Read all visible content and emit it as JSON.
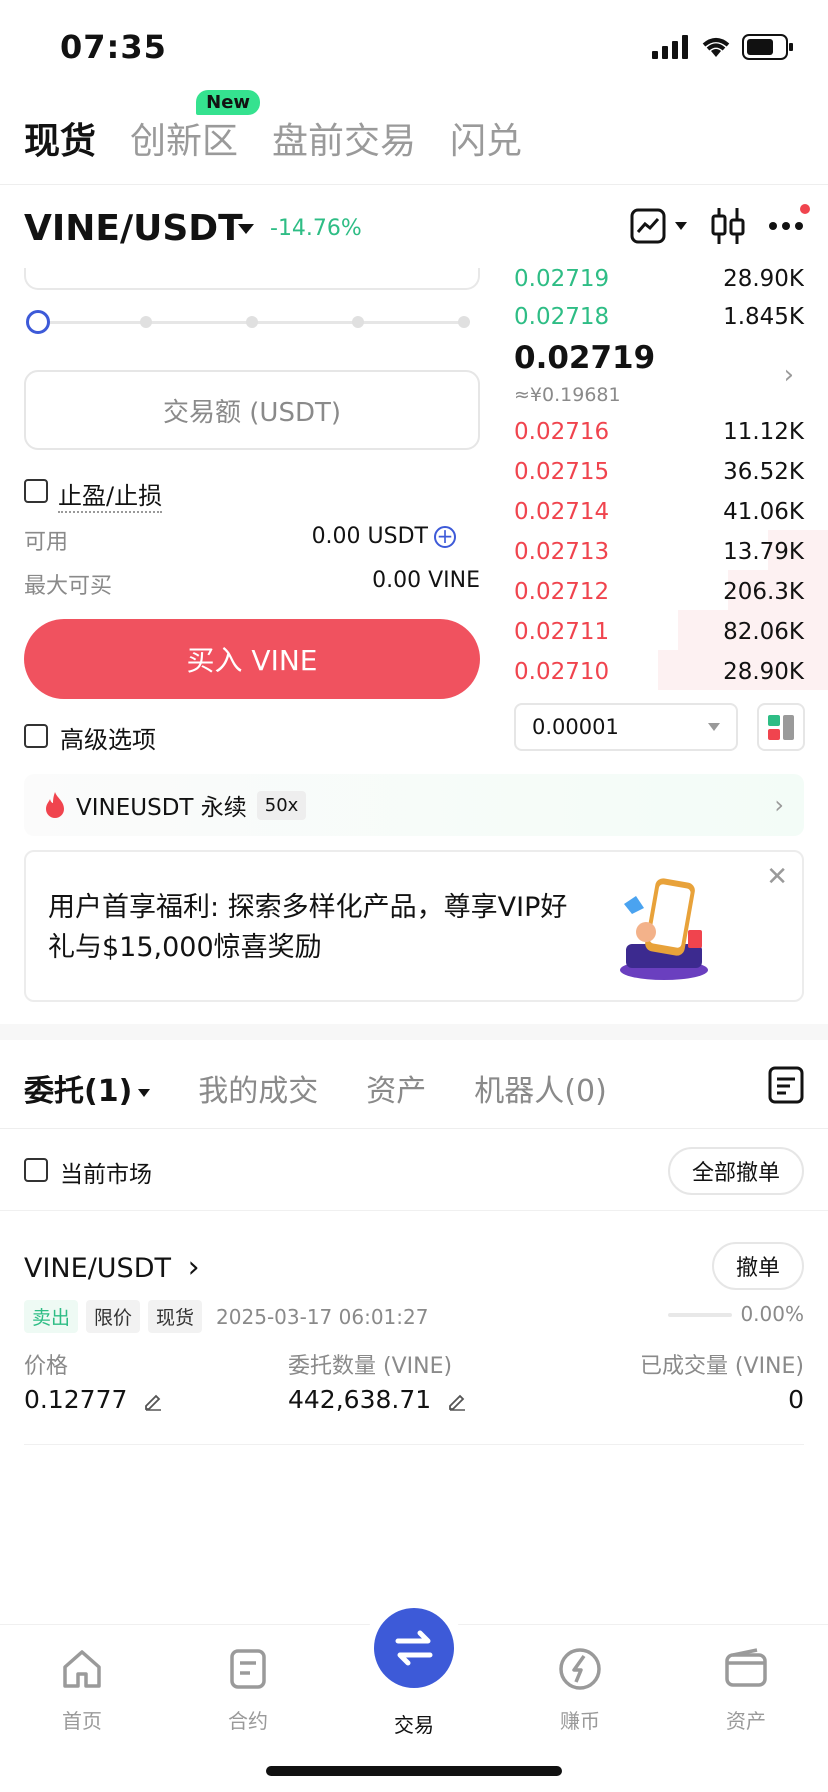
{
  "status_bar": {
    "time": "07:35"
  },
  "top_tabs": [
    {
      "label": "现货",
      "active": true
    },
    {
      "label": "创新区",
      "badge": "New"
    },
    {
      "label": "盘前交易"
    },
    {
      "label": "闪兑"
    }
  ],
  "pair": {
    "name": "VINE/USDT",
    "change": "-14.76%"
  },
  "form": {
    "amount_placeholder": "交易额 (USDT)",
    "tpsl_label": "止盈/止损",
    "available_label": "可用",
    "available_value": "0.00 USDT",
    "max_buy_label": "最大可买",
    "max_buy_value": "0.00 VINE",
    "buy_button": "买入 VINE",
    "advanced_label": "高级选项"
  },
  "order_book": {
    "bids": [
      {
        "price": "0.02719",
        "qty": "28.90K"
      },
      {
        "price": "0.02718",
        "qty": "1.845K"
      }
    ],
    "mid_price": "0.02719",
    "mid_cny": "≈¥0.19681",
    "asks": [
      {
        "price": "0.02716",
        "qty": "11.12K"
      },
      {
        "price": "0.02715",
        "qty": "36.52K"
      },
      {
        "price": "0.02714",
        "qty": "41.06K"
      },
      {
        "price": "0.02713",
        "qty": "13.79K"
      },
      {
        "price": "0.02712",
        "qty": "206.3K"
      },
      {
        "price": "0.02711",
        "qty": "82.06K"
      },
      {
        "price": "0.02710",
        "qty": "28.90K"
      }
    ],
    "tick_size": "0.00001"
  },
  "perp_banner": {
    "label": "VINEUSDT 永续",
    "leverage": "50x"
  },
  "promo": {
    "text": "用户首享福利: 探索多样化产品，尊享VIP好礼与$15,000惊喜奖励"
  },
  "order_tabs": [
    {
      "label": "委托(1)",
      "active": true
    },
    {
      "label": "我的成交"
    },
    {
      "label": "资产"
    },
    {
      "label": "机器人(0)"
    }
  ],
  "filters": {
    "current_market": "当前市场",
    "cancel_all": "全部撤单"
  },
  "order": {
    "pair": "VINE/USDT",
    "cancel": "撤单",
    "side": "卖出",
    "type": "限价",
    "market": "现货",
    "time": "2025-03-17 06:01:27",
    "filled_pct": "0.00%",
    "price_label": "价格",
    "price": "0.12777",
    "amount_label": "委托数量 (VINE)",
    "amount": "442,638.71",
    "filled_label": "已成交量 (VINE)",
    "filled": "0"
  },
  "bottom_nav": [
    {
      "label": "首页"
    },
    {
      "label": "合约"
    },
    {
      "label": "交易",
      "active": true
    },
    {
      "label": "赚币"
    },
    {
      "label": "资产"
    }
  ],
  "colors": {
    "accent": "#3d5ad8",
    "buy": "#f0525f",
    "green": "#2ebd85",
    "red": "#f0444e"
  }
}
